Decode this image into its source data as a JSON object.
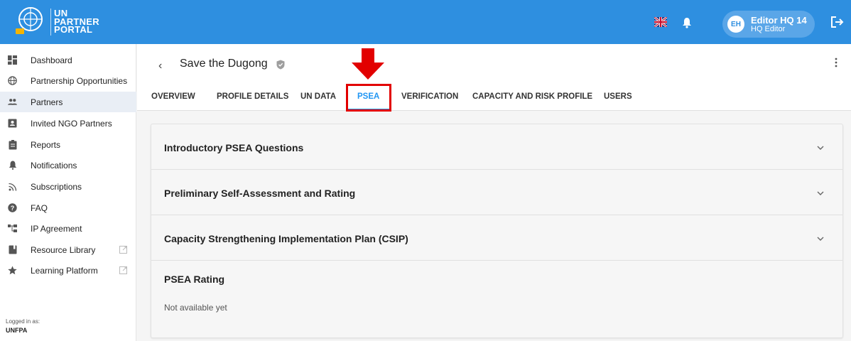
{
  "header": {
    "brand_line1": "UN",
    "brand_line2": "PARTNER",
    "brand_line3": "PORTAL",
    "user_initials": "EH",
    "user_name": "Editor HQ 14",
    "user_role": "HQ Editor"
  },
  "sidebar": {
    "items": [
      {
        "label": "Dashboard",
        "icon": "dashboard-icon"
      },
      {
        "label": "Partnership Opportunities",
        "icon": "globe-icon"
      },
      {
        "label": "Partners",
        "icon": "people-icon"
      },
      {
        "label": "Invited NGO Partners",
        "icon": "contact-card-icon"
      },
      {
        "label": "Reports",
        "icon": "clipboard-icon"
      },
      {
        "label": "Notifications",
        "icon": "bell-icon"
      },
      {
        "label": "Subscriptions",
        "icon": "rss-icon"
      },
      {
        "label": "FAQ",
        "icon": "help-icon"
      },
      {
        "label": "IP Agreement",
        "icon": "hierarchy-icon"
      },
      {
        "label": "Resource Library",
        "icon": "book-icon"
      },
      {
        "label": "Learning Platform",
        "icon": "star-icon"
      }
    ],
    "active_item": "Partners",
    "logged_in_label": "Logged in as:",
    "logged_in_org": "UNFPA"
  },
  "page": {
    "title": "Save the Dugong",
    "tabs": [
      "OVERVIEW",
      "PROFILE DETAILS",
      "UN DATA",
      "PSEA",
      "VERIFICATION",
      "CAPACITY AND RISK PROFILE",
      "USERS"
    ],
    "active_tab": "PSEA"
  },
  "sections": [
    {
      "title": "Introductory PSEA Questions"
    },
    {
      "title": "Preliminary Self-Assessment and Rating"
    },
    {
      "title": "Capacity Strengthening Implementation Plan (CSIP)"
    }
  ],
  "rating": {
    "title": "PSEA Rating",
    "value": "Not available yet"
  },
  "colors": {
    "header": "#2e8fe0",
    "accent": "#2196f3",
    "highlight": "#e20000"
  }
}
